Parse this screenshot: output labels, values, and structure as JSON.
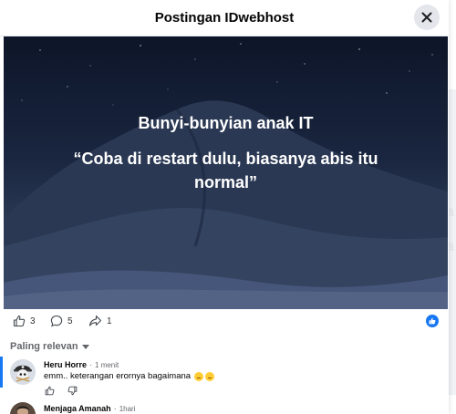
{
  "dialog": {
    "title": "Postingan IDwebhost"
  },
  "post": {
    "heading": "Bunyi-bunyian anak IT",
    "quote": "“Coba di restart dulu, biasanya abis itu normal”"
  },
  "reactions": {
    "likes": "3",
    "comments": "5",
    "shares": "1"
  },
  "comments_section": {
    "sort_label": "Paling relevan"
  },
  "comments": [
    {
      "author": "Heru Horre",
      "time": "1 menit",
      "text": "emm.. keterangan erornya bagaimana",
      "emojis": [
        "thinking-face-icon",
        "thinking-face-icon"
      ]
    },
    {
      "author": "Menjaga Amanah",
      "time": "1hari"
    }
  ],
  "background": {
    "letter_1": "a",
    "letter_2": "a"
  },
  "colors": {
    "accent": "#1877f2",
    "image_top": "#0d1528",
    "image_bottom": "#3d4c69",
    "muted_text": "#65676b"
  }
}
